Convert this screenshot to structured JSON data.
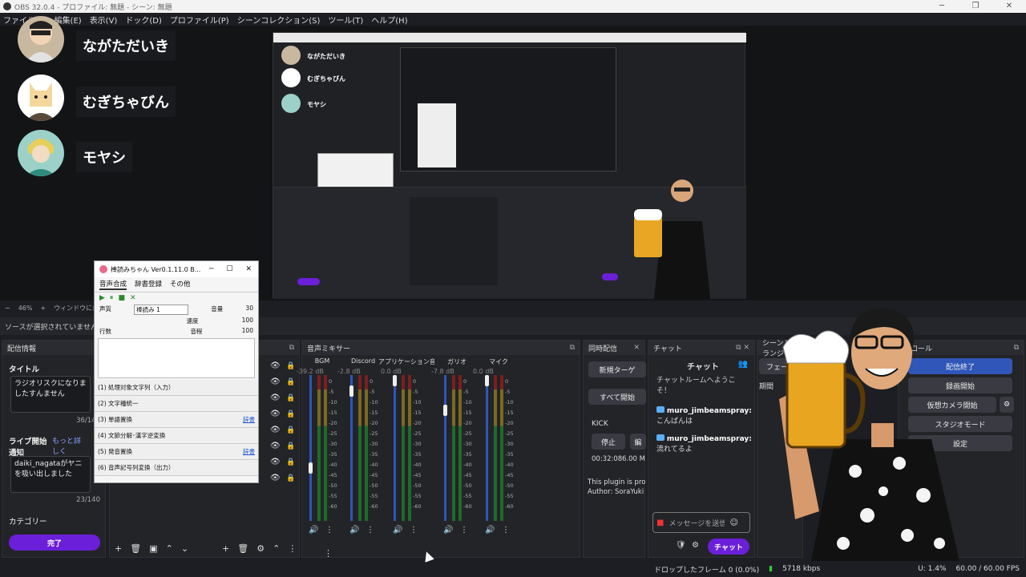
{
  "window": {
    "title": "OBS 32.0.4 - プロファイル: 無題 - シーン: 無題",
    "controls": [
      "─",
      "❐",
      "✕"
    ]
  },
  "menu": [
    "ファイル(F)",
    "編集(E)",
    "表示(V)",
    "ドック(D)",
    "プロファイル(P)",
    "シーンコレクション(S)",
    "ツール(T)",
    "ヘルプ(H)"
  ],
  "participants": [
    {
      "name": "ながただいき"
    },
    {
      "name": "むぎちゃびん"
    },
    {
      "name": "モヤシ"
    }
  ],
  "preview_participants": [
    "ながただいき",
    "むぎちゃびん",
    "モヤシ"
  ],
  "zoom": {
    "minus": "−",
    "value": "46%",
    "plus": "+",
    "fit": "ウィンドウに合わせる"
  },
  "source_status": "ソースが選択されていません",
  "stream_info": {
    "header": "配信情報",
    "title_label": "タイトル",
    "title_value": "ラジオリスクになりましたすんません",
    "title_count": "36/140",
    "live_label": "ライブ開始通知",
    "more_link": "もっと詳しく",
    "notify_value": "daiki_nagataがヤニを吸い出しました",
    "notify_count": "23/140",
    "category_label": "カテゴリー",
    "done_button": "完了"
  },
  "tts": {
    "title": "棒読みちゃん Ver0.1.11.0 B...",
    "tabs": [
      "音声合成",
      "辞書登録",
      "その他"
    ],
    "voice_label": "声質",
    "voice_value": "棒読み 1",
    "params": [
      {
        "label": "音量",
        "value": "30"
      },
      {
        "label": "速度",
        "value": "100"
      },
      {
        "label": "音程",
        "value": "100"
      }
    ],
    "line_label": "行数",
    "steps": [
      {
        "label": "(1) 処理対象文字列（入力）",
        "link": ""
      },
      {
        "label": "(2) 文字種統一",
        "link": ""
      },
      {
        "label": "(3) 単語置換",
        "link": "辞書"
      },
      {
        "label": "(4) 文節分解･漢字逆変換",
        "link": ""
      },
      {
        "label": "(5) 発音置換",
        "link": "辞書"
      },
      {
        "label": "(6) 音声記号列変換（出力）",
        "link": ""
      }
    ]
  },
  "mixer": {
    "header": "音声ミキサー",
    "channels": [
      {
        "name": "BGM",
        "db": "-39.2 dB",
        "fader": 0.35
      },
      {
        "name": "Discord",
        "db": "-2.8 dB",
        "fader": 0.92
      },
      {
        "name": "アプリケーション音声キャ",
        "db": "0.0 dB",
        "fader": 1.0
      },
      {
        "name": "ガリオ",
        "db": "-7.8 dB",
        "fader": 0.78
      },
      {
        "name": "マイク",
        "db": "0.0 dB",
        "fader": 1.0
      }
    ],
    "scale": [
      "0",
      "-5",
      "-10",
      "-15",
      "-20",
      "-25",
      "-30",
      "-35",
      "-40",
      "-45",
      "-50",
      "-55",
      "-60"
    ]
  },
  "multistream": {
    "header": "同時配信",
    "new_target": "新規ターゲ",
    "start_all": "すべて開始",
    "platform": "KICK",
    "stop": "停止",
    "edit": "編",
    "time": "00:32:08",
    "rate": "6.00 Mb",
    "info": "This plugin is prov",
    "author": "Author: SoraYuki ("
  },
  "chat": {
    "header": "チャット",
    "title": "チャット",
    "welcome": "チャットルームへようこそ！",
    "messages": [
      {
        "user": "muro_jimbeamspray:",
        "text": "こんばんは"
      },
      {
        "user": "muro_jimbeamspray:",
        "text": "流れてるよ"
      }
    ],
    "input_placeholder": "メッセージを送信",
    "send": "チャット"
  },
  "transitions": {
    "header": "シーントランジ",
    "fade": "フェード",
    "duration": "期間"
  },
  "controls": {
    "header": "トロール",
    "buttons": [
      "配信終了",
      "録画開始",
      "仮想カメラ開始",
      "スタジオモード",
      "設定"
    ]
  },
  "status": {
    "dropped": "ドロップしたフレーム 0 (0.0%)",
    "bitrate": "5718 kbps",
    "cpu": "U: 1.4%",
    "fps": "60.00 / 60.00 FPS"
  },
  "colors": {
    "accent": "#6b1fd8",
    "bg": "#1d1e23",
    "panel": "#232428"
  }
}
